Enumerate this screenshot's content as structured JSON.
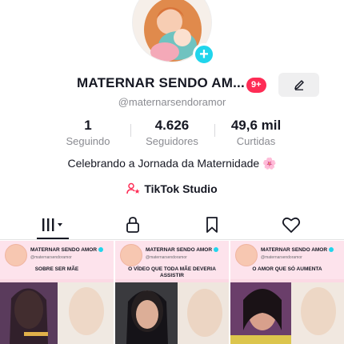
{
  "profile": {
    "name": "MATERNAR SENDO AM...",
    "notification_badge": "9+",
    "handle": "@maternarsendoramor",
    "bio": "Celebrando a Jornada da Maternidade 🌸",
    "add_icon": "plus-icon",
    "edit_icon": "pencil-icon"
  },
  "stats": [
    {
      "value": "1",
      "label": "Seguindo"
    },
    {
      "value": "4.626",
      "label": "Seguidores"
    },
    {
      "value": "49,6 mil",
      "label": "Curtidas"
    }
  ],
  "studio": {
    "label": "TikTok Studio",
    "icon": "person-star-icon"
  },
  "tabs": [
    {
      "icon": "videos-grid-icon",
      "active": true
    },
    {
      "icon": "lock-icon",
      "active": false
    },
    {
      "icon": "bookmark-icon",
      "active": false
    },
    {
      "icon": "heart-icon",
      "active": false
    }
  ],
  "videos": [
    {
      "channel": "MATERNAR SENDO AMOR",
      "handle": "@maternarsendoramor",
      "title": "SOBRE SER MÃE"
    },
    {
      "channel": "MATERNAR SENDO AMOR",
      "handle": "@maternarsendoramor",
      "title": "O VÍDEO QUE TODA MÃE DEVERIA ASSISTIR"
    },
    {
      "channel": "MATERNAR SENDO AMOR",
      "handle": "@maternarsendoramor",
      "title": "O AMOR QUE SÓ AUMENTA"
    }
  ],
  "colors": {
    "accent": "#fe2c55",
    "add": "#20d5ec",
    "muted": "#8a8b91",
    "thumb_bg": "#fbd9e4"
  }
}
